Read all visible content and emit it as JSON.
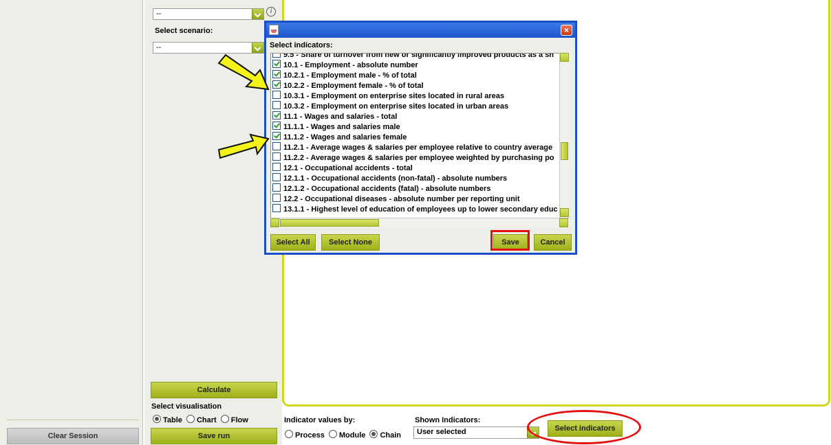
{
  "left": {
    "clear_session": "Clear Session"
  },
  "middle": {
    "top_select_value": "--",
    "scenario_label": "Select scenario:",
    "scenario_value": "--",
    "calculate": "Calculate",
    "vis_label": "Select visualisation",
    "vis_options": [
      "Table",
      "Chart",
      "Flow"
    ],
    "vis_selected": "Table",
    "save_run": "Save run"
  },
  "bottom": {
    "values_by_label": "Indicator values by:",
    "values_by_options": [
      "Process",
      "Module",
      "Chain"
    ],
    "values_by_selected": "Chain",
    "shown_label": "Shown Indicators:",
    "shown_value": "User selected",
    "select_indicators": "Select indicators"
  },
  "dialog": {
    "heading": "Select indicators:",
    "close": "×",
    "items": [
      {
        "label": "9.5 - Share of turnover from new or significantly improved products as a sh",
        "checked": false
      },
      {
        "label": "10.1 - Employment - absolute number",
        "checked": true
      },
      {
        "label": "10.2.1 - Employment male - % of total",
        "checked": true
      },
      {
        "label": "10.2.2 - Employment female - % of total",
        "checked": true
      },
      {
        "label": "10.3.1 - Employment on enterprise sites located in rural areas",
        "checked": false
      },
      {
        "label": "10.3.2 - Employment on enterprise sites located in urban areas",
        "checked": false
      },
      {
        "label": "11.1 - Wages and salaries - total",
        "checked": true
      },
      {
        "label": "11.1.1 - Wages and salaries male",
        "checked": true
      },
      {
        "label": "11.1.2 - Wages and salaries female",
        "checked": true
      },
      {
        "label": "11.2.1 - Average wages & salaries per employee relative to country average",
        "checked": false
      },
      {
        "label": "11.2.2 - Average wages & salaries per employee weighted by purchasing po",
        "checked": false
      },
      {
        "label": "12.1 - Occupational accidents - total",
        "checked": false
      },
      {
        "label": "12.1.1 - Occupational accidents (non-fatal) - absolute numbers",
        "checked": false
      },
      {
        "label": "12.1.2 - Occupational accidents (fatal) - absolute numbers",
        "checked": false
      },
      {
        "label": "12.2 - Occupational diseases - absolute number per reporting unit",
        "checked": false
      },
      {
        "label": "13.1.1 - Highest level of education of employees up to lower secondary educ",
        "checked": false
      }
    ],
    "select_all": "Select All",
    "select_none": "Select None",
    "save": "Save",
    "cancel": "Cancel"
  },
  "colors": {
    "accent_olive": "#a9b820",
    "frame_border": "#cdd81c",
    "dialog_border": "#1b4fc8",
    "annotation_red": "#e41010",
    "annotation_arrow": "#f3f31a"
  }
}
